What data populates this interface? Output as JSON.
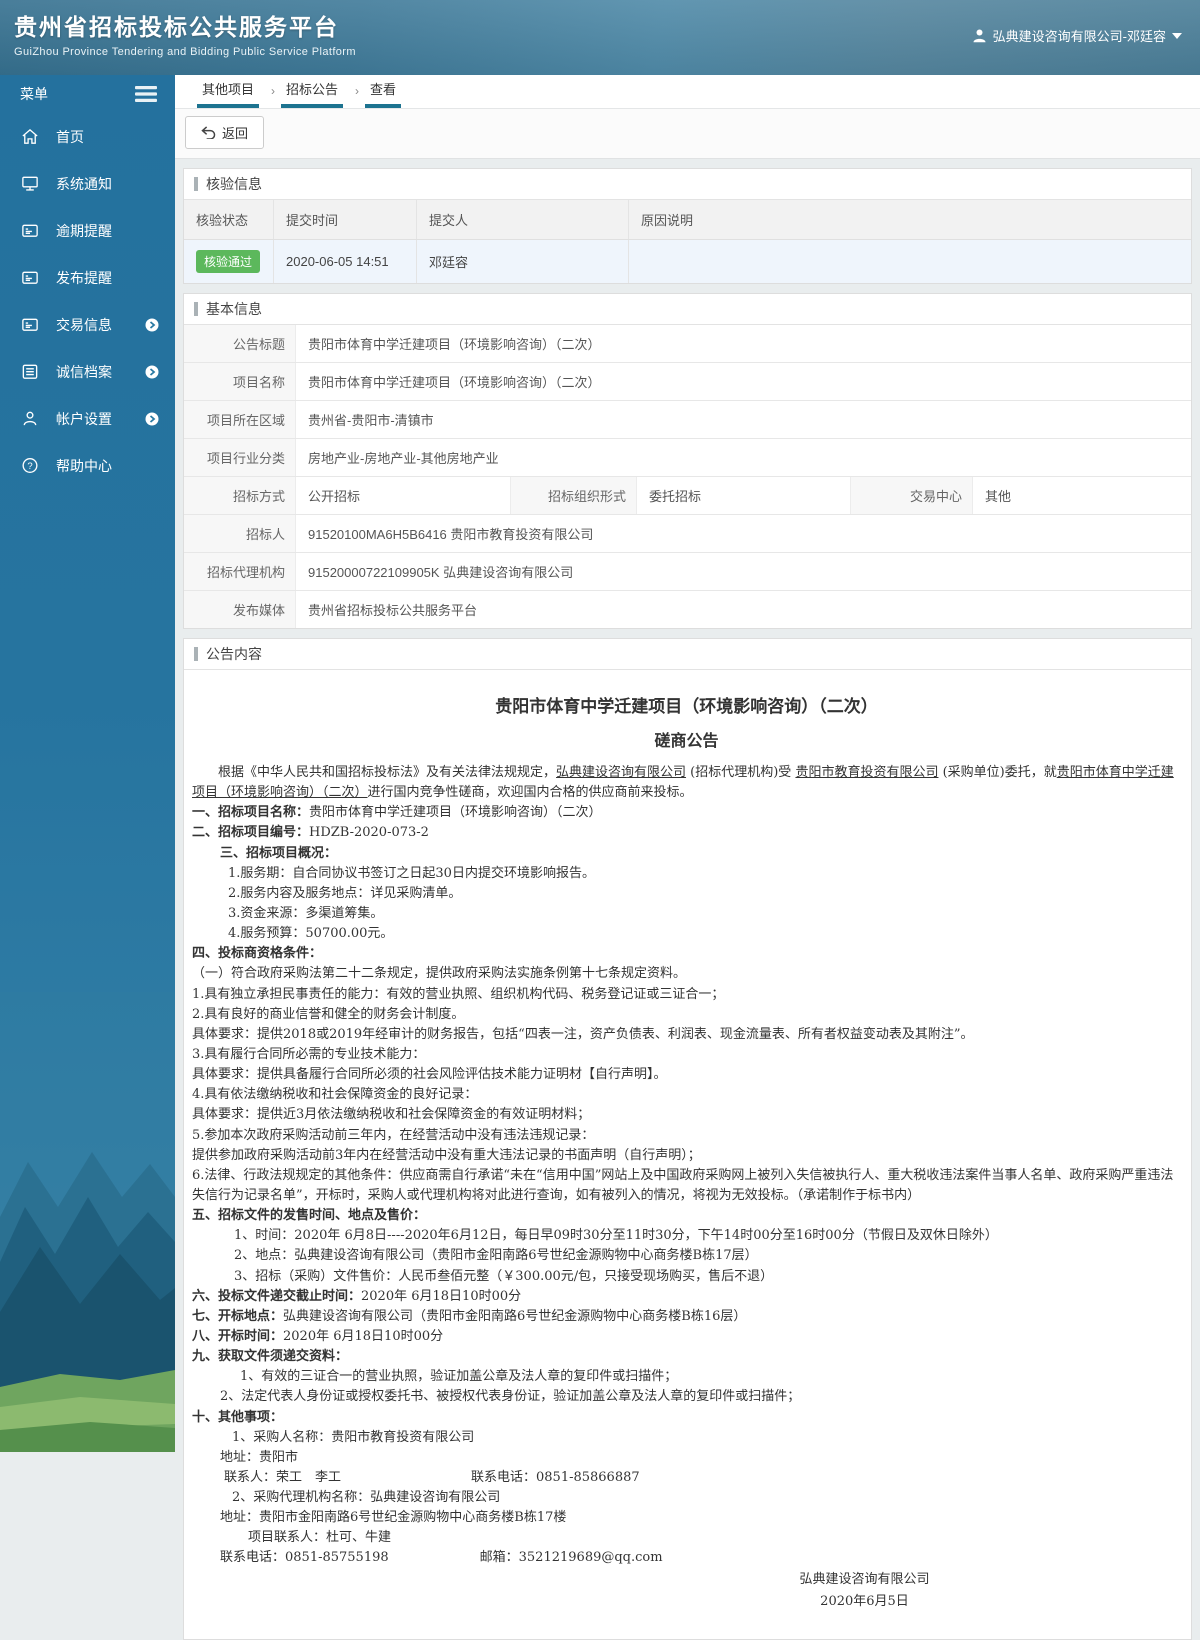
{
  "colors": {
    "accent_teal": "#1d7390",
    "header_blue": "#3f7a99",
    "sidebar_blue": "#24719e",
    "badge_green": "#5cb85c",
    "row_highlight": "#eff5fc"
  },
  "header": {
    "title": "贵州省招标投标公共服务平台",
    "subtitle": "GuiZhou Province Tendering and Bidding Public Service Platform",
    "user": "弘典建设咨询有限公司-邓廷容"
  },
  "sidebar": {
    "menu_label": "菜单",
    "items": [
      {
        "label": "首页",
        "icon": "home-icon",
        "submenu": false
      },
      {
        "label": "系统通知",
        "icon": "monitor-icon",
        "submenu": false
      },
      {
        "label": "逾期提醒",
        "icon": "card-icon",
        "submenu": false
      },
      {
        "label": "发布提醒",
        "icon": "card-icon",
        "submenu": false
      },
      {
        "label": "交易信息",
        "icon": "card-icon",
        "submenu": true
      },
      {
        "label": "诚信档案",
        "icon": "list-icon",
        "submenu": true
      },
      {
        "label": "帐户设置",
        "icon": "person-icon",
        "submenu": true
      },
      {
        "label": "帮助中心",
        "icon": "help-icon",
        "submenu": false
      }
    ]
  },
  "breadcrumb": [
    "其他项目",
    "招标公告",
    "查看"
  ],
  "toolbar": {
    "back_label": "返回"
  },
  "verification": {
    "section_title": "核验信息",
    "columns": [
      "核验状态",
      "提交时间",
      "提交人",
      "原因说明"
    ],
    "row": {
      "status": "核验通过",
      "time": "2020-06-05 14:51",
      "submitter": "邓廷容",
      "reason": ""
    }
  },
  "basic_info": {
    "section_title": "基本信息",
    "rows": [
      {
        "cells": [
          {
            "label": "公告标题",
            "value": "贵阳市体育中学迁建项目（环境影响咨询）（二次）"
          }
        ]
      },
      {
        "cells": [
          {
            "label": "项目名称",
            "value": "贵阳市体育中学迁建项目（环境影响咨询）（二次）"
          }
        ]
      },
      {
        "cells": [
          {
            "label": "项目所在区域",
            "value": "贵州省-贵阳市-清镇市"
          }
        ]
      },
      {
        "cells": [
          {
            "label": "项目行业分类",
            "value": "房地产业-房地产业-其他房地产业"
          }
        ]
      },
      {
        "cells": [
          {
            "label": "招标方式",
            "value": "公开招标"
          },
          {
            "label": "招标组织形式",
            "value": "委托招标"
          },
          {
            "label": "交易中心",
            "value": "其他"
          }
        ]
      },
      {
        "cells": [
          {
            "label": "招标人",
            "value": "91520100MA6H5B6416 贵阳市教育投资有限公司"
          }
        ]
      },
      {
        "cells": [
          {
            "label": "招标代理机构",
            "value": "91520000722109905K 弘典建设咨询有限公司"
          }
        ]
      },
      {
        "cells": [
          {
            "label": "发布媒体",
            "value": "贵州省招标投标公共服务平台"
          }
        ]
      }
    ]
  },
  "announcement": {
    "section_title": "公告内容",
    "title": "贵阳市体育中学迁建项目（环境影响咨询）（二次）",
    "subtitle": "磋商公告",
    "signature": "弘典建设咨询有限公司",
    "date": "2020年6月5日",
    "lines": [
      {
        "para": true,
        "segs": [
          {
            "t": "根据《中华人民共和国招标投标法》及有关法律法规规定，"
          },
          {
            "t": "弘典建设咨询有限公司",
            "u": 1
          },
          {
            "t": " (招标代理机构)受 "
          },
          {
            "t": "贵阳市教育投资有限公司",
            "u": 1
          },
          {
            "t": " (采购单位)委托，就"
          },
          {
            "t": "贵阳市体育中学迁建项目（环境影响咨询）（二次）",
            "u": 1
          },
          {
            "t": "进行国内竞争性磋商，欢迎国内合格的供应商前来投标。"
          }
        ]
      },
      {
        "segs": [
          {
            "t": "一、招标项目名称：",
            "b": 1
          },
          {
            "t": "贵阳市体育中学迁建项目（环境影响咨询）（二次）"
          }
        ]
      },
      {
        "segs": [
          {
            "t": "二、招标项目编号：",
            "b": 1
          },
          {
            "t": "HDZB-2020-073-2"
          }
        ]
      },
      {
        "ind": 28,
        "segs": [
          {
            "t": "三、招标项目概况：",
            "b": 1
          }
        ]
      },
      {
        "ind": 36,
        "segs": [
          {
            "t": "1.服务期：自合同协议书签订之日起30日内提交环境影响报告。"
          }
        ]
      },
      {
        "ind": 36,
        "segs": [
          {
            "t": "2.服务内容及服务地点：详见采购清单。"
          }
        ]
      },
      {
        "ind": 36,
        "segs": [
          {
            "t": "3.资金来源：多渠道筹集。"
          }
        ]
      },
      {
        "ind": 36,
        "segs": [
          {
            "t": "4.服务预算：50700.00元。"
          }
        ]
      },
      {
        "segs": [
          {
            "t": "四、投标商资格条件：",
            "b": 1
          }
        ]
      },
      {
        "segs": [
          {
            "t": "（一）符合政府采购法第二十二条规定，提供政府采购法实施条例第十七条规定资料。"
          }
        ]
      },
      {
        "segs": [
          {
            "t": "1.具有独立承担民事责任的能力：有效的营业执照、组织机构代码、税务登记证或三证合一；"
          }
        ]
      },
      {
        "segs": [
          {
            "t": "2.具有良好的商业信誉和健全的财务会计制度。"
          }
        ]
      },
      {
        "segs": [
          {
            "t": "具体要求：提供2018或2019年经审计的财务报告，包括“四表一注，资产负债表、利润表、现金流量表、所有者权益变动表及其附注”。"
          }
        ]
      },
      {
        "segs": [
          {
            "t": "3.具有履行合同所必需的专业技术能力："
          }
        ]
      },
      {
        "segs": [
          {
            "t": "具体要求：提供具备履行合同所必须的社会风险评估技术能力证明材【自行声明】。"
          }
        ]
      },
      {
        "segs": [
          {
            "t": "4.具有依法缴纳税收和社会保障资金的良好记录："
          }
        ]
      },
      {
        "segs": [
          {
            "t": "具体要求：提供近3月依法缴纳税收和社会保障资金的有效证明材料；"
          }
        ]
      },
      {
        "segs": [
          {
            "t": "5.参加本次政府采购活动前三年内，在经营活动中没有违法违规记录："
          }
        ]
      },
      {
        "segs": [
          {
            "t": "提供参加政府采购活动前3年内在经营活动中没有重大违法记录的书面声明（自行声明）；"
          }
        ]
      },
      {
        "segs": [
          {
            "t": "6.法律、行政法规规定的其他条件：供应商需自行承诺“未在“信用中国”网站上及中国政府采购网上被列入失信被执行人、重大税收违法案件当事人名单、政府采购严重违法失信行为记录名单”，开标时，采购人或代理机构将对此进行查询，如有被列入的情况，将视为无效投标。（承诺制作于标书内）"
          }
        ]
      },
      {
        "segs": [
          {
            "t": "五、招标文件的发售时间、地点及售价：",
            "b": 1
          }
        ]
      },
      {
        "ind": 42,
        "segs": [
          {
            "t": "1、时间：2020年 6月8日----2020年6月12日，每日早09时30分至11时30分，下午14时00分至16时00分（节假日及双休日除外）"
          }
        ]
      },
      {
        "ind": 42,
        "segs": [
          {
            "t": "2、地点：弘典建设咨询有限公司（贵阳市金阳南路6号世纪金源购物中心商务楼B栋17层）"
          }
        ]
      },
      {
        "ind": 42,
        "segs": [
          {
            "t": "3、招标（采购）文件售价：人民币叁佰元整（￥300.00元/包，只接受现场购买，售后不退）"
          }
        ]
      },
      {
        "segs": [
          {
            "t": "六、投标文件递交截止时间：",
            "b": 1
          },
          {
            "t": "2020年 6月18日10时00分"
          }
        ]
      },
      {
        "segs": [
          {
            "t": "七、开标地点：",
            "b": 1
          },
          {
            "t": "弘典建设咨询有限公司（贵阳市金阳南路6号世纪金源购物中心商务楼B栋16层）"
          }
        ]
      },
      {
        "segs": [
          {
            "t": "八、开标时间：",
            "b": 1
          },
          {
            "t": "2020年 6月18日10时00分"
          }
        ]
      },
      {
        "segs": [
          {
            "t": "九、获取文件须递交资料：",
            "b": 1
          }
        ]
      },
      {
        "ind": 48,
        "segs": [
          {
            "t": "1、有效的三证合一的营业执照，验证加盖公章及法人章的复印件或扫描件；"
          }
        ]
      },
      {
        "ind": 28,
        "segs": [
          {
            "t": "2、法定代表人身份证或授权委托书、被授权代表身份证，验证加盖公章及法人章的复印件或扫描件；"
          }
        ]
      },
      {
        "segs": [
          {
            "t": "十、其他事项：",
            "b": 1
          }
        ]
      },
      {
        "ind": 40,
        "segs": [
          {
            "t": "1、采购人名称：贵阳市教育投资有限公司"
          }
        ]
      },
      {
        "ind": 28,
        "segs": [
          {
            "t": "地址：贵阳市"
          }
        ]
      },
      {
        "ind": 32,
        "segs": [
          {
            "t": "联系人：荣工　李工　　　　　　　　　　联系电话：0851-85866887"
          }
        ]
      },
      {
        "ind": 40,
        "segs": [
          {
            "t": "2、采购代理机构名称：弘典建设咨询有限公司"
          }
        ]
      },
      {
        "ind": 28,
        "segs": [
          {
            "t": "地址：贵阳市金阳南路6号世纪金源购物中心商务楼B栋17楼"
          }
        ]
      },
      {
        "ind": 56,
        "segs": [
          {
            "t": "项目联系人：杜可、牛建"
          }
        ]
      },
      {
        "ind": 28,
        "segs": [
          {
            "t": "联系电话：0851-85755198　　　　　　　邮箱：3521219689@qq.com"
          }
        ]
      }
    ]
  }
}
